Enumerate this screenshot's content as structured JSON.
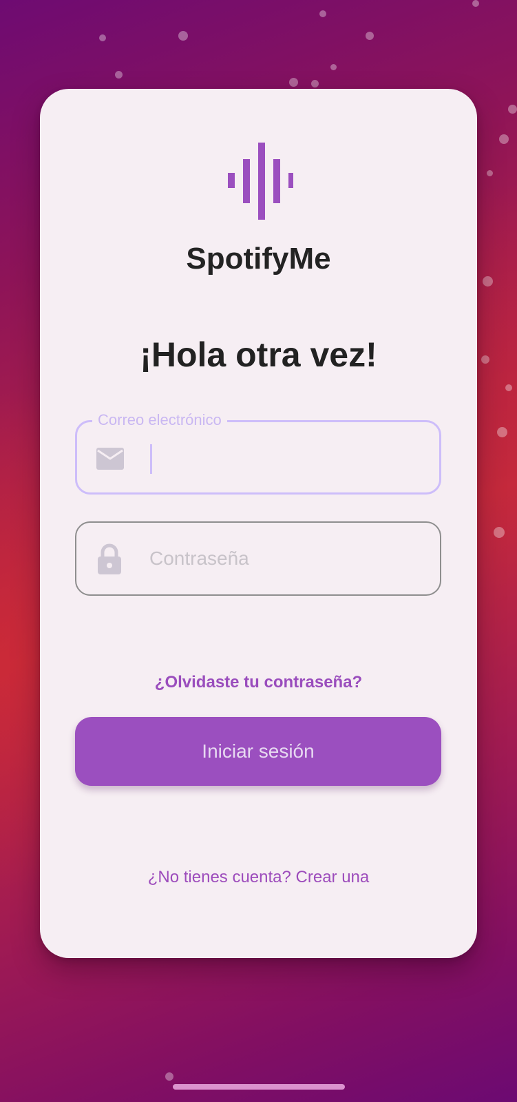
{
  "app": {
    "name": "SpotifyMe",
    "logo_icon": "soundwave-logo-icon",
    "brand_color": "#9b4fbf"
  },
  "login": {
    "greeting": "¡Hola otra vez!",
    "email_field": {
      "label": "Correo electrónico",
      "value": "",
      "icon": "mail-icon",
      "state": "focused"
    },
    "password_field": {
      "placeholder": "Contraseña",
      "value": "",
      "icon": "lock-icon"
    },
    "forgot_password_link": "¿Olvidaste tu contraseña?",
    "submit_button": "Iniciar sesión",
    "signup_link": "¿No tienes cuenta? Crear una"
  },
  "colors": {
    "background_start": "#6e0b72",
    "background_mid": "#c52a3c",
    "card_background": "#f6eef3",
    "focus_border": "#cdbdfa",
    "link": "#9a4dbd"
  }
}
